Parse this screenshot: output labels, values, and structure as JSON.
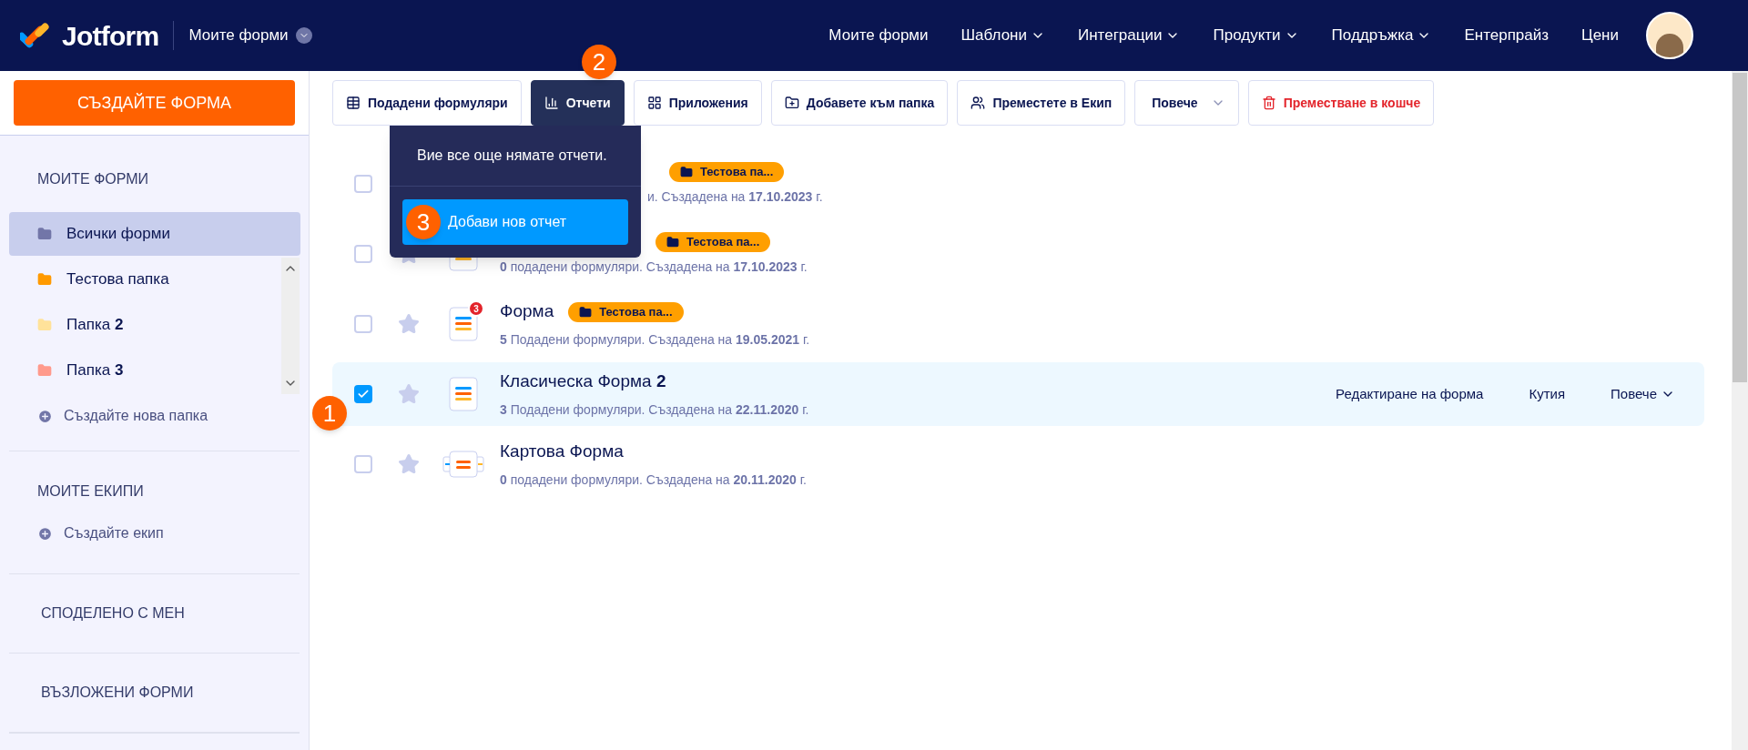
{
  "header": {
    "logo": "Jotform",
    "workspace": "Моите форми",
    "nav": [
      {
        "label": "Моите форми",
        "dropdown": false
      },
      {
        "label": "Шаблони",
        "dropdown": true
      },
      {
        "label": "Интеграции",
        "dropdown": true
      },
      {
        "label": "Продукти",
        "dropdown": true
      },
      {
        "label": "Поддръжка",
        "dropdown": true
      },
      {
        "label": "Ентерпрайз",
        "dropdown": false
      },
      {
        "label": "Цени",
        "dropdown": false
      }
    ]
  },
  "sidebar": {
    "create_button": "СЪЗДАЙТЕ ФОРМА",
    "my_forms_heading": "МОИТЕ ФОРМИ",
    "folders": [
      {
        "label": "Всички форми",
        "color": "#7276a8",
        "selected": true
      },
      {
        "label": "Тестова папка",
        "color": "#ff9a00",
        "selected": false
      },
      {
        "label": "Папка **2**",
        "color": "#ffe29a",
        "selected": false
      },
      {
        "label": "Папка **3**",
        "color": "#ff9a8c",
        "selected": false
      }
    ],
    "new_folder": "Създайте нова папка",
    "teams_heading": "МОИТЕ ЕКИПИ",
    "new_team": "Създайте екип",
    "shared_heading": "СПОДЕЛЕНО С МЕН",
    "assigned_heading": "ВЪЗЛОЖЕНИ ФОРМИ"
  },
  "toolbar": [
    {
      "label": "Подадени формуляри",
      "kind": "button",
      "selected": false
    },
    {
      "label": "Отчети",
      "kind": "button",
      "selected": true,
      "marker": "2"
    },
    {
      "label": "Приложения",
      "kind": "button",
      "selected": false
    },
    {
      "label": "Добавете към папка",
      "kind": "button",
      "selected": false
    },
    {
      "label": "Преместете в Екип",
      "kind": "button",
      "selected": false
    },
    {
      "label": "Повече",
      "kind": "dropdown",
      "selected": false
    },
    {
      "label": "Преместване в кошче",
      "kind": "danger",
      "selected": false
    }
  ],
  "reports_popup": {
    "message": "Вие все още нямате отчети.",
    "button": "Добави нов отчет",
    "marker": "3"
  },
  "forms": [
    {
      "kind": "covered",
      "tag": "Тестова па...",
      "meta": "и. Създадена на **17.10.2023** г.",
      "selected": false
    },
    {
      "kind": "title_covered",
      "tag": "Тестова па...",
      "meta": "**0** подадени формуляри. Създадена на **17.10.2023** г.",
      "selected": false
    },
    {
      "kind": "list",
      "title": "Форма",
      "badge": "3",
      "tag": "Тестова па...",
      "meta": "**5** Подадени формуляри. Създадена на **19.05.2021** г.",
      "selected": false
    },
    {
      "kind": "list",
      "title": "Класическа Форма **2**",
      "meta": "**3** Подадени формуляри. Създадена на **22.11.2020** г.",
      "selected": true,
      "marker": "1",
      "actions": [
        "Редактиране на форма",
        "Кутия",
        "Повече"
      ]
    },
    {
      "kind": "card",
      "title": "Картова Форма",
      "meta": "**0** подадени формуляри. Създадена на **20.11.2020** г.",
      "selected": false
    }
  ]
}
